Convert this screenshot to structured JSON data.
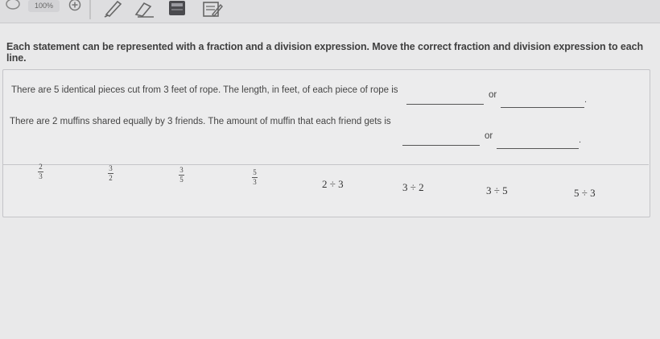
{
  "toolbar": {
    "zoom": "100%",
    "tools": [
      "help-bubble-icon",
      "zoom-in-icon",
      "pen-icon",
      "eraser-icon",
      "calculator-icon",
      "notepad-icon"
    ]
  },
  "prompt": "Each statement can be represented with a fraction and a division expression. Move the correct fraction and division expression to each line.",
  "statements": [
    {
      "text": "There are 5 identical pieces cut from 3 feet of rope. The length, in feet, of each piece of rope is",
      "or": "or",
      "end": "."
    },
    {
      "text": "There are 2 muffins shared equally by 3 friends. The amount of muffin that each friend gets is",
      "or": "or",
      "end": "."
    }
  ],
  "choices": {
    "fractions": [
      {
        "num": "2",
        "den": "3"
      },
      {
        "num": "3",
        "den": "2"
      },
      {
        "num": "3",
        "den": "5"
      },
      {
        "num": "5",
        "den": "3"
      }
    ],
    "expressions": [
      "2 ÷ 3",
      "3 ÷ 2",
      "3 ÷ 5",
      "5 ÷ 3"
    ]
  }
}
